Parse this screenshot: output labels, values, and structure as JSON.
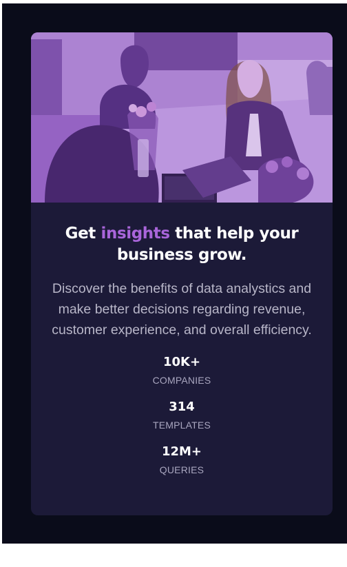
{
  "colors": {
    "page_background": "#0a0c1a",
    "card_background": "#1c1a38",
    "accent": "#a965da",
    "heading": "#ffffff",
    "body_text": "#b8b6c8",
    "stat_label": "#a9a6bf"
  },
  "card": {
    "hero_image": "office-team-photo-purple-tint",
    "headline": {
      "before": "Get ",
      "accent": "insights",
      "after": " that help your business grow."
    },
    "description": "Discover the benefits of data analystics and make better decisions regarding revenue, customer experience, and overall efficiency.",
    "stats": [
      {
        "value": "10K+",
        "label": "COMPANIES"
      },
      {
        "value": "314",
        "label": "TEMPLATES"
      },
      {
        "value": "12M+",
        "label": "QUERIES"
      }
    ]
  }
}
